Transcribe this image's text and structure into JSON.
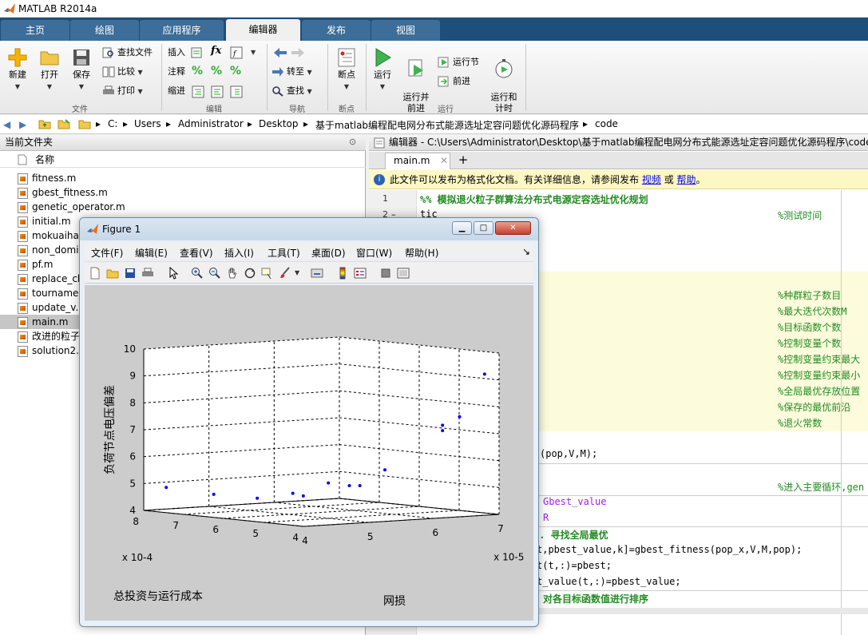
{
  "app": {
    "title": "MATLAB R2014a"
  },
  "tabs": [
    "主页",
    "绘图",
    "应用程序",
    "编辑器",
    "发布",
    "视图"
  ],
  "ribbon": {
    "file": {
      "new": "新建",
      "open": "打开",
      "save": "保存",
      "find_files": "查找文件",
      "compare": "比较",
      "print": "打印",
      "group": "文件"
    },
    "edit": {
      "insert": "插入",
      "comment": "注释",
      "indent": "缩进",
      "fx": "fx",
      "group": "编辑"
    },
    "nav": {
      "goto": "转至",
      "find": "查找",
      "group": "导航"
    },
    "breakpoints": {
      "label": "断点",
      "group": "断点"
    },
    "run": {
      "run": "运行",
      "run_advance": "运行并\n前进",
      "run_section": "运行节",
      "advance": "前进",
      "run_time": "运行和\n计时",
      "group": "运行"
    }
  },
  "address": {
    "parts": [
      "C:",
      "Users",
      "Administrator",
      "Desktop",
      "基于matlab编程配电网分布式能源选址定容问题优化源码程序",
      "code"
    ]
  },
  "current_folder": {
    "title": "当前文件夹",
    "column": "名称",
    "files": [
      "fitness.m",
      "gbest_fitness.m",
      "genetic_operator.m",
      "initial.m",
      "mokuaiha",
      "non_domi",
      "pf.m",
      "replace_ch",
      "tourname",
      "update_v.r",
      "main.m",
      "改进的粒子",
      "solution2.i"
    ]
  },
  "editor": {
    "title": "编辑器 - C:\\Users\\Administrator\\Desktop\\基于matlab编程配电网分布式能源选址定容问题优化源码程序\\code",
    "tab": "main.m",
    "info": "此文件可以发布为格式化文档。有关详细信息，请参阅发布",
    "info_link1": "视频",
    "info_or": "或",
    "info_link2": "帮助",
    "info_end": "。",
    "line1": "%% 模拟退火粒子群算法分布式电源定容选址优化规划",
    "line2": "tic",
    "c_time": "%测试时间",
    "c_pop": "%种群粒子数目",
    "c_iter": "%最大迭代次数M",
    "c_obj": "%目标函数个数",
    "c_var": "%控制变量个数",
    "c_ub": "%控制变量约束最大",
    "c_lb": "%控制变量约束最小",
    "c_pos": "%全局最优存放位置",
    "c_front": "%保存的最优前沿",
    "c_anneal": "%退火常数",
    "code_pop": "(pop,V,M);",
    "c_loop": "%进入主要循环,gen",
    "code_gbest": "Gbest_value",
    "code_R": "R",
    "c_find": "1. 寻找全局最优",
    "code_fit": "t,pbest_value,k]=gbest_fitness(pop_x,V,M,pop);",
    "code_pbest": "t(t,:)=pbest;",
    "code_pv": "t_value(t,:)=pbest_value;",
    "c_sort": "对各目标函数值进行排序"
  },
  "figure": {
    "title": "Figure 1",
    "menu": [
      "文件(F)",
      "编辑(E)",
      "查看(V)",
      "插入(I)",
      "工具(T)",
      "桌面(D)",
      "窗口(W)",
      "帮助(H)"
    ]
  },
  "chart_data": {
    "type": "scatter",
    "title": "",
    "xlabel": "总投资与运行成本",
    "ylabel": "网损",
    "zlabel": "负荷节点电压偏差",
    "x_scale_label": "x 10^-4",
    "y_scale_label": "x 10^-5",
    "xlim": [
      4,
      8
    ],
    "ylim": [
      4,
      7
    ],
    "zlim": [
      4,
      10
    ],
    "x_ticks": [
      "4",
      "5",
      "6",
      "7",
      "8"
    ],
    "y_ticks": [
      "4",
      "5",
      "6",
      "7"
    ],
    "z_ticks": [
      "4",
      "5",
      "6",
      "7",
      "8",
      "9",
      "10"
    ],
    "grid": true,
    "color": "#0000ff",
    "points": [
      {
        "x": 7.6,
        "y": 4.1,
        "z": 4.9
      },
      {
        "x": 6.9,
        "y": 4.4,
        "z": 4.7
      },
      {
        "x": 6.3,
        "y": 4.7,
        "z": 4.6
      },
      {
        "x": 5.9,
        "y": 5.0,
        "z": 4.8
      },
      {
        "x": 5.8,
        "y": 5.1,
        "z": 4.7
      },
      {
        "x": 5.5,
        "y": 5.3,
        "z": 5.2
      },
      {
        "x": 5.3,
        "y": 5.5,
        "z": 5.1
      },
      {
        "x": 5.2,
        "y": 5.6,
        "z": 5.1
      },
      {
        "x": 4.9,
        "y": 5.8,
        "z": 5.7
      },
      {
        "x": 4.6,
        "y": 6.5,
        "z": 7.3
      },
      {
        "x": 4.6,
        "y": 6.5,
        "z": 7.1
      },
      {
        "x": 4.5,
        "y": 6.7,
        "z": 7.6
      },
      {
        "x": 4.2,
        "y": 6.9,
        "z": 9.2
      }
    ]
  }
}
